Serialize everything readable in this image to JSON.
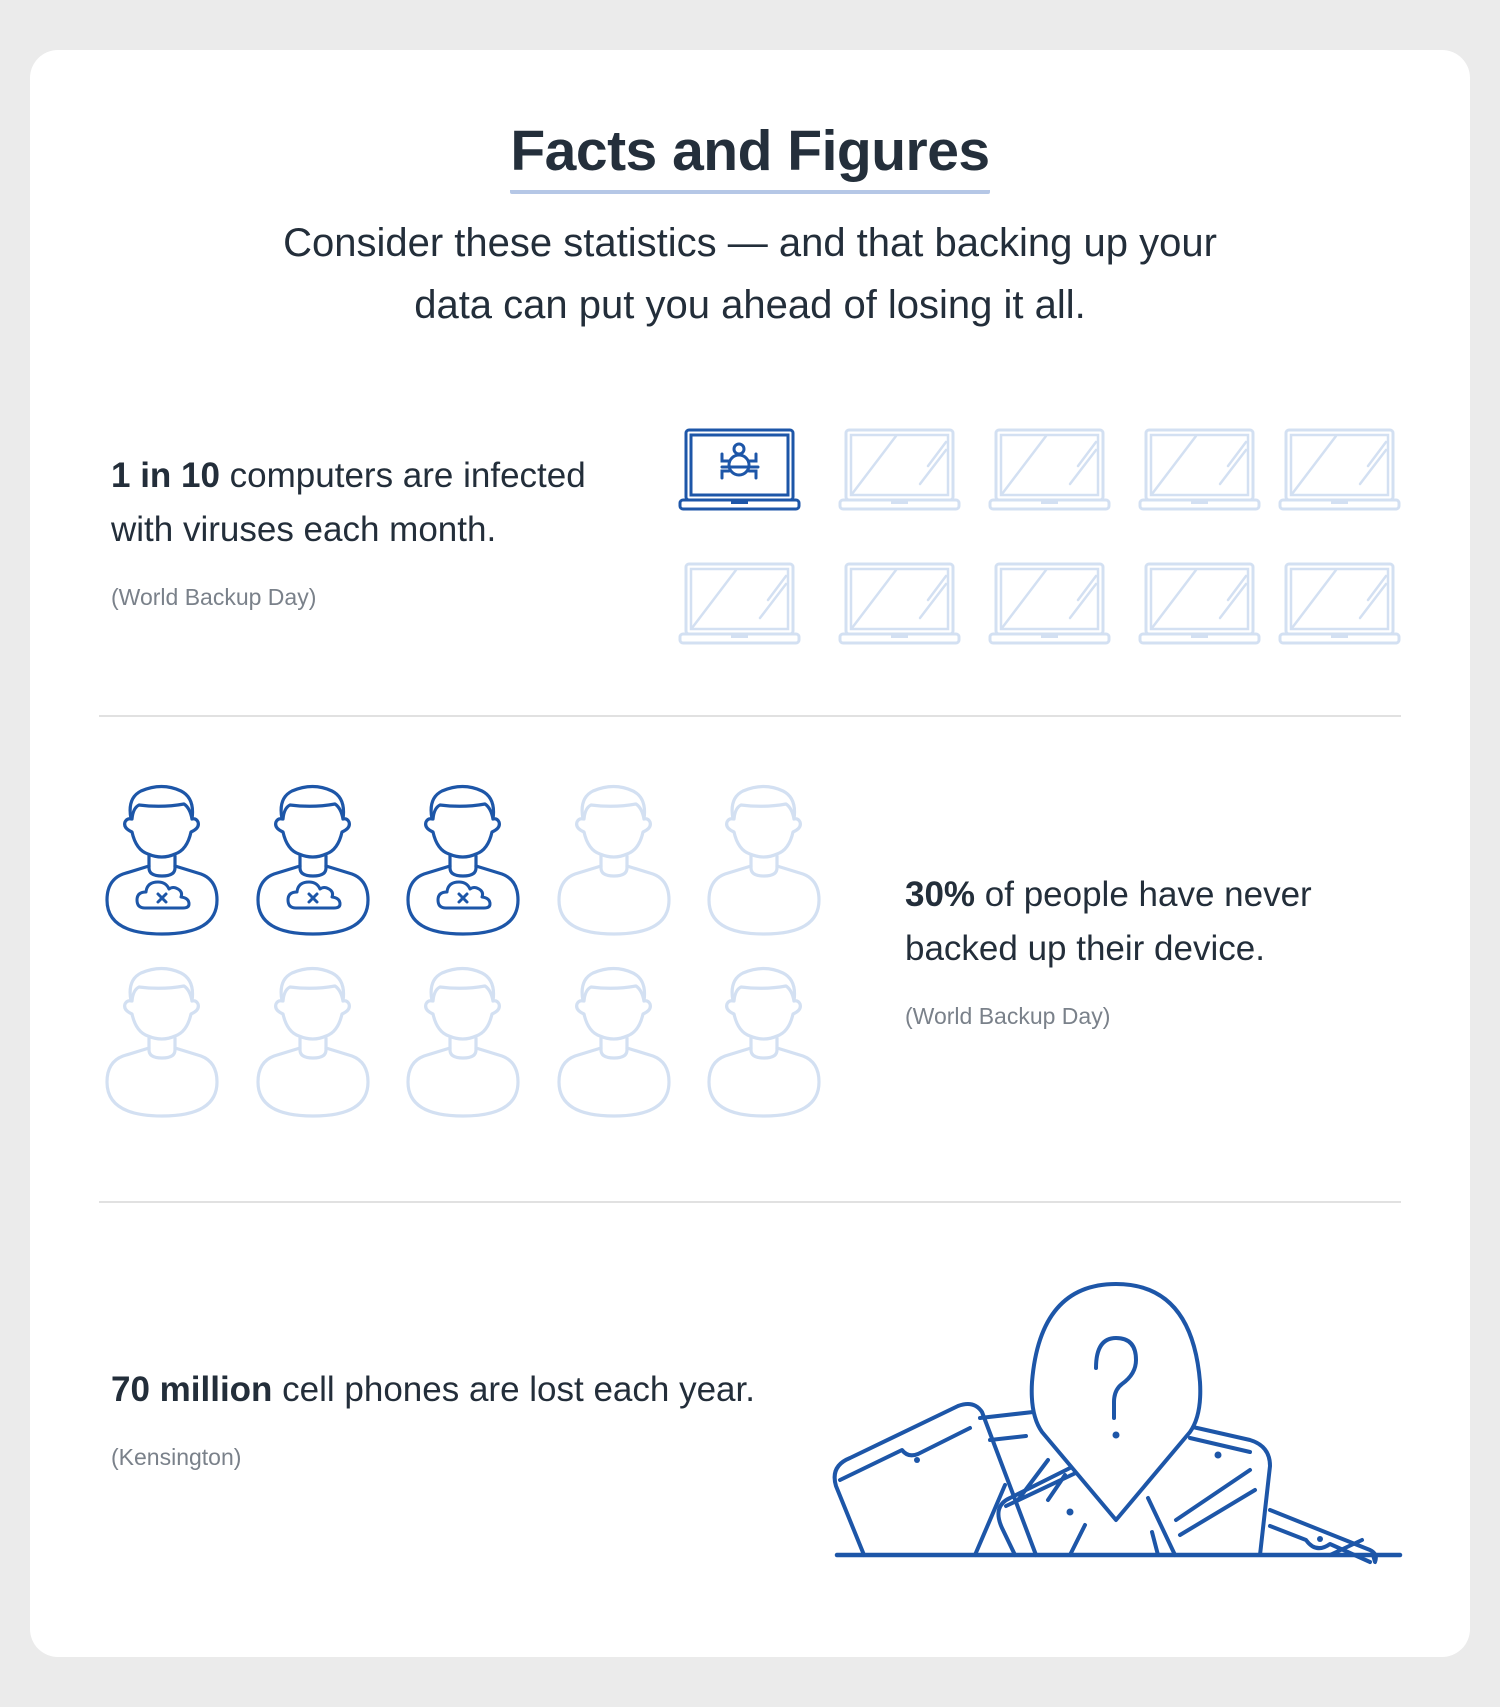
{
  "header": {
    "title": "Facts and Figures",
    "subtitle_line1": "Consider these statistics — and that backing up your",
    "subtitle_line2": "data can put you ahead of losing it all."
  },
  "colors": {
    "accent_dark": "#1d56a8",
    "accent_light": "#d3e0f2",
    "title_underline": "#b5c7e6",
    "text": "#232e3a",
    "source_text": "#7a818a",
    "page_background": "#ebebeb"
  },
  "sections": [
    {
      "highlight": "1 in 10",
      "text_line1": " computers are infected",
      "text_line2": "with viruses each month.",
      "source": "(World Backup Day)",
      "icon": "laptop-icon",
      "highlighted_icon": "laptop-bug-icon",
      "total_icons": 10,
      "highlighted_count": 1
    },
    {
      "highlight": "30%",
      "text_line1": " of people have never",
      "text_line2": "backed up their device.",
      "source": "(World Backup Day)",
      "icon": "person-icon",
      "highlighted_icon": "person-cloud-error-icon",
      "total_icons": 10,
      "highlighted_count": 3
    },
    {
      "highlight": "70 million",
      "text_line1": " cell phones are lost each year.",
      "source": "(Kensington)",
      "icon": "lost-phones-location-pin-icon"
    }
  ]
}
